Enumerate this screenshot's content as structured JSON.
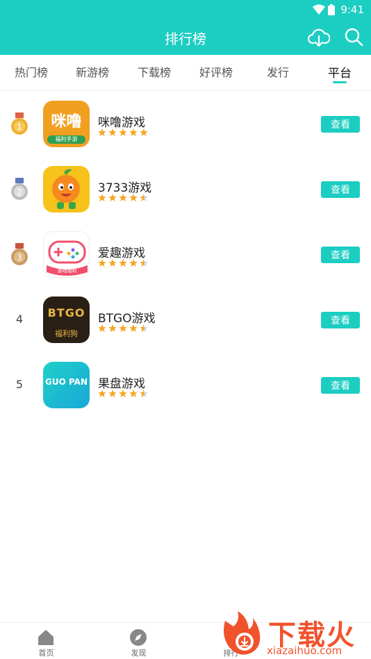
{
  "status_bar": {
    "time": "9:41"
  },
  "app_bar": {
    "title": "排行榜"
  },
  "tabs": [
    {
      "label": "热门榜"
    },
    {
      "label": "新游榜"
    },
    {
      "label": "下载榜"
    },
    {
      "label": "好评榜"
    },
    {
      "label": "发行"
    },
    {
      "label": "平台"
    }
  ],
  "active_tab": "平台",
  "items": [
    {
      "rank": "1",
      "name": "咪噜游戏",
      "rating": 5,
      "action": "查看",
      "icon_text": "咪噜",
      "icon_subtext": "福利手游"
    },
    {
      "rank": "2",
      "name": "3733游戏",
      "rating": 4.5,
      "action": "查看"
    },
    {
      "rank": "3",
      "name": "爱趣游戏",
      "rating": 4.5,
      "action": "查看",
      "icon_subtext": "游戏福利"
    },
    {
      "rank": "4",
      "name": "BTGO游戏",
      "rating": 4.5,
      "action": "查看",
      "icon_text": "BTGO",
      "icon_subtext": "福利狗"
    },
    {
      "rank": "5",
      "name": "果盘游戏",
      "rating": 4.5,
      "action": "查看",
      "icon_text": "GUO PAN"
    }
  ],
  "bottom_nav": [
    {
      "label": "首页"
    },
    {
      "label": "发现"
    },
    {
      "label": "排行"
    }
  ],
  "watermark": {
    "text": "下载火",
    "url_text": "xiazaihuo.com"
  },
  "colors": {
    "accent": "#1ccdc2",
    "star": "#f5a623",
    "gold": "#f0a020",
    "silver": "#b5b5b5",
    "bronze": "#d3a876"
  }
}
